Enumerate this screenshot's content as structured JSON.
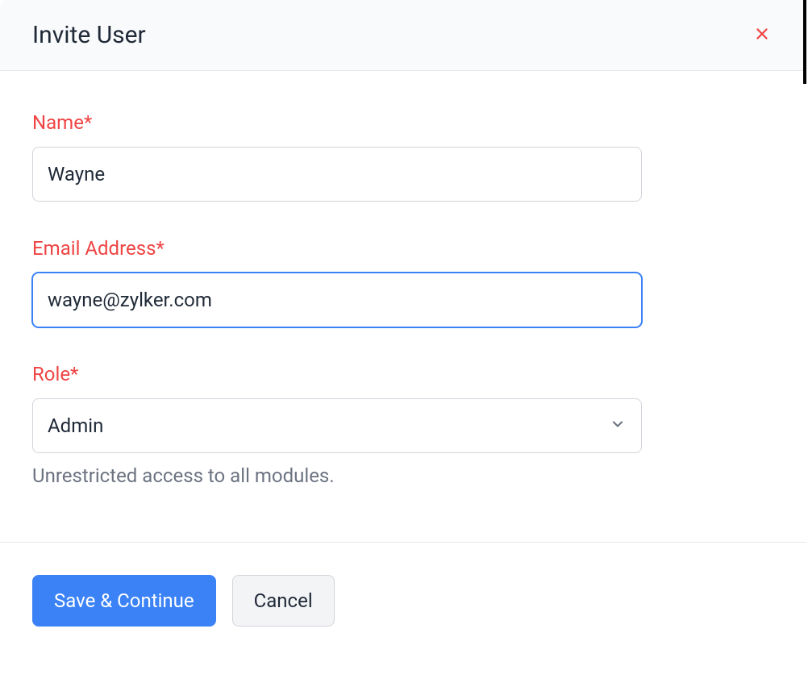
{
  "modal": {
    "title": "Invite User"
  },
  "form": {
    "name": {
      "label": "Name*",
      "value": "Wayne"
    },
    "email": {
      "label": "Email Address*",
      "value": "wayne@zylker.com"
    },
    "role": {
      "label": "Role*",
      "value": "Admin",
      "help": "Unrestricted access to all modules."
    }
  },
  "actions": {
    "save": "Save & Continue",
    "cancel": "Cancel"
  }
}
